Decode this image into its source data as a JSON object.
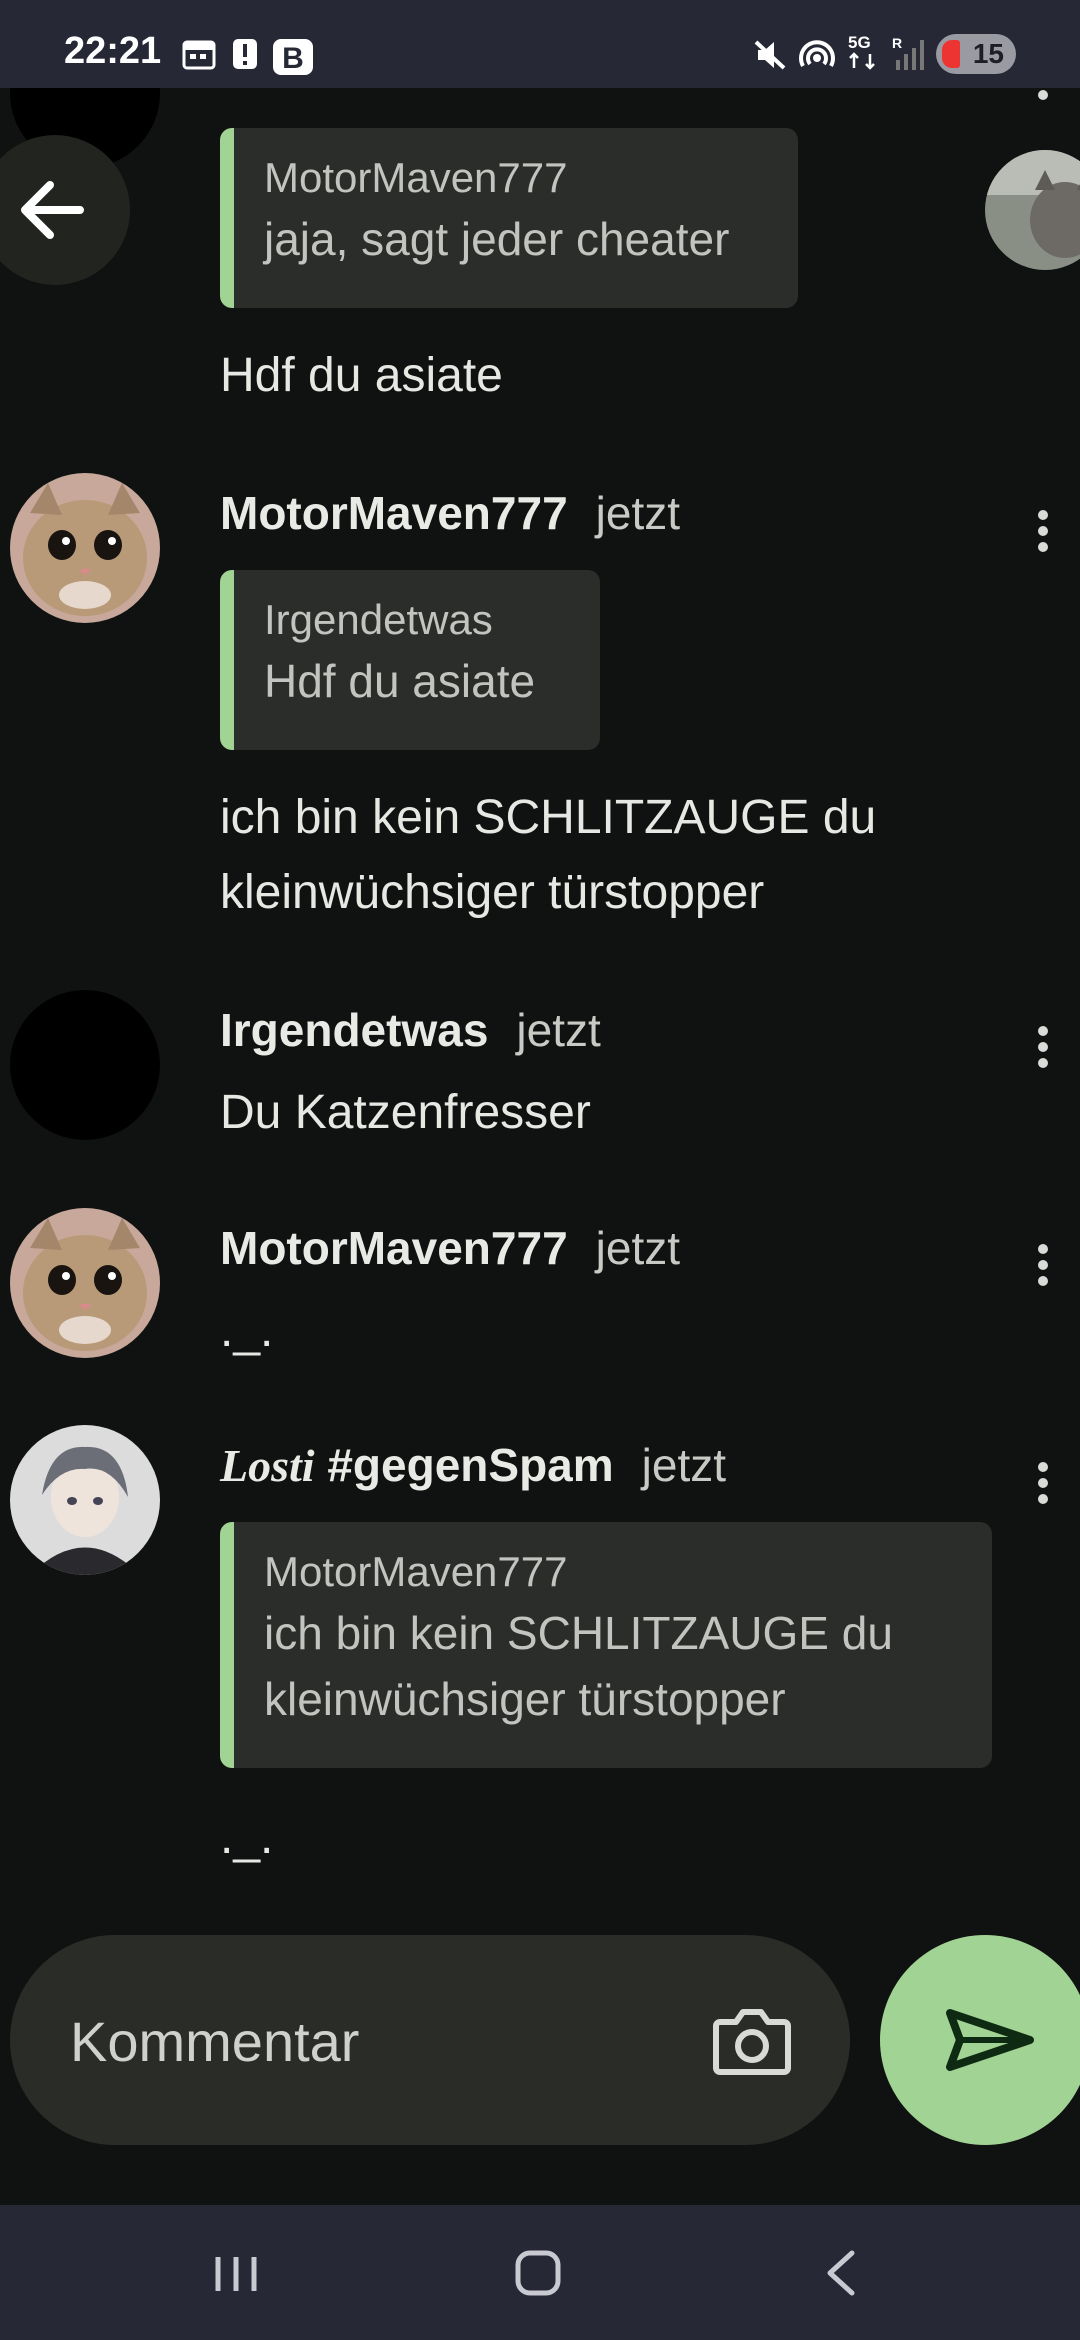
{
  "status_bar": {
    "time": "22:21",
    "battery": "15"
  },
  "right_avatar_name": "cat-photo-avatar",
  "feed": {
    "partial_item": {
      "quote_author": "MotorMaven777",
      "quote_text": "jaja, sagt jeder cheater",
      "message": "Hdf du asiate"
    },
    "comments": [
      {
        "author": "MotorMaven777",
        "time": "jetzt",
        "quote_author": "Irgendetwas",
        "quote_text": "Hdf du asiate",
        "message_line1": "ich bin kein SCHLITZAUGE du",
        "message_line2": "kleinwüchsiger türstopper"
      },
      {
        "author": "Irgendetwas",
        "time": "jetzt",
        "message": "Du Katzenfresser"
      },
      {
        "author": "MotorMaven777",
        "time": "jetzt",
        "message": "._."
      },
      {
        "author_styled": "Losti",
        "author_rest": "#gegenSpam",
        "time": "jetzt",
        "quote_author": "MotorMaven777",
        "quote_text_line1": "ich bin kein SCHLITZAUGE du",
        "quote_text_line2": "kleinwüchsiger türstopper",
        "message": "._."
      }
    ]
  },
  "composer": {
    "placeholder": "Kommentar"
  },
  "colors": {
    "background": "#101211",
    "accent": "#a1d494",
    "quote_bg": "#2b2d2a",
    "bars": "#262836"
  }
}
